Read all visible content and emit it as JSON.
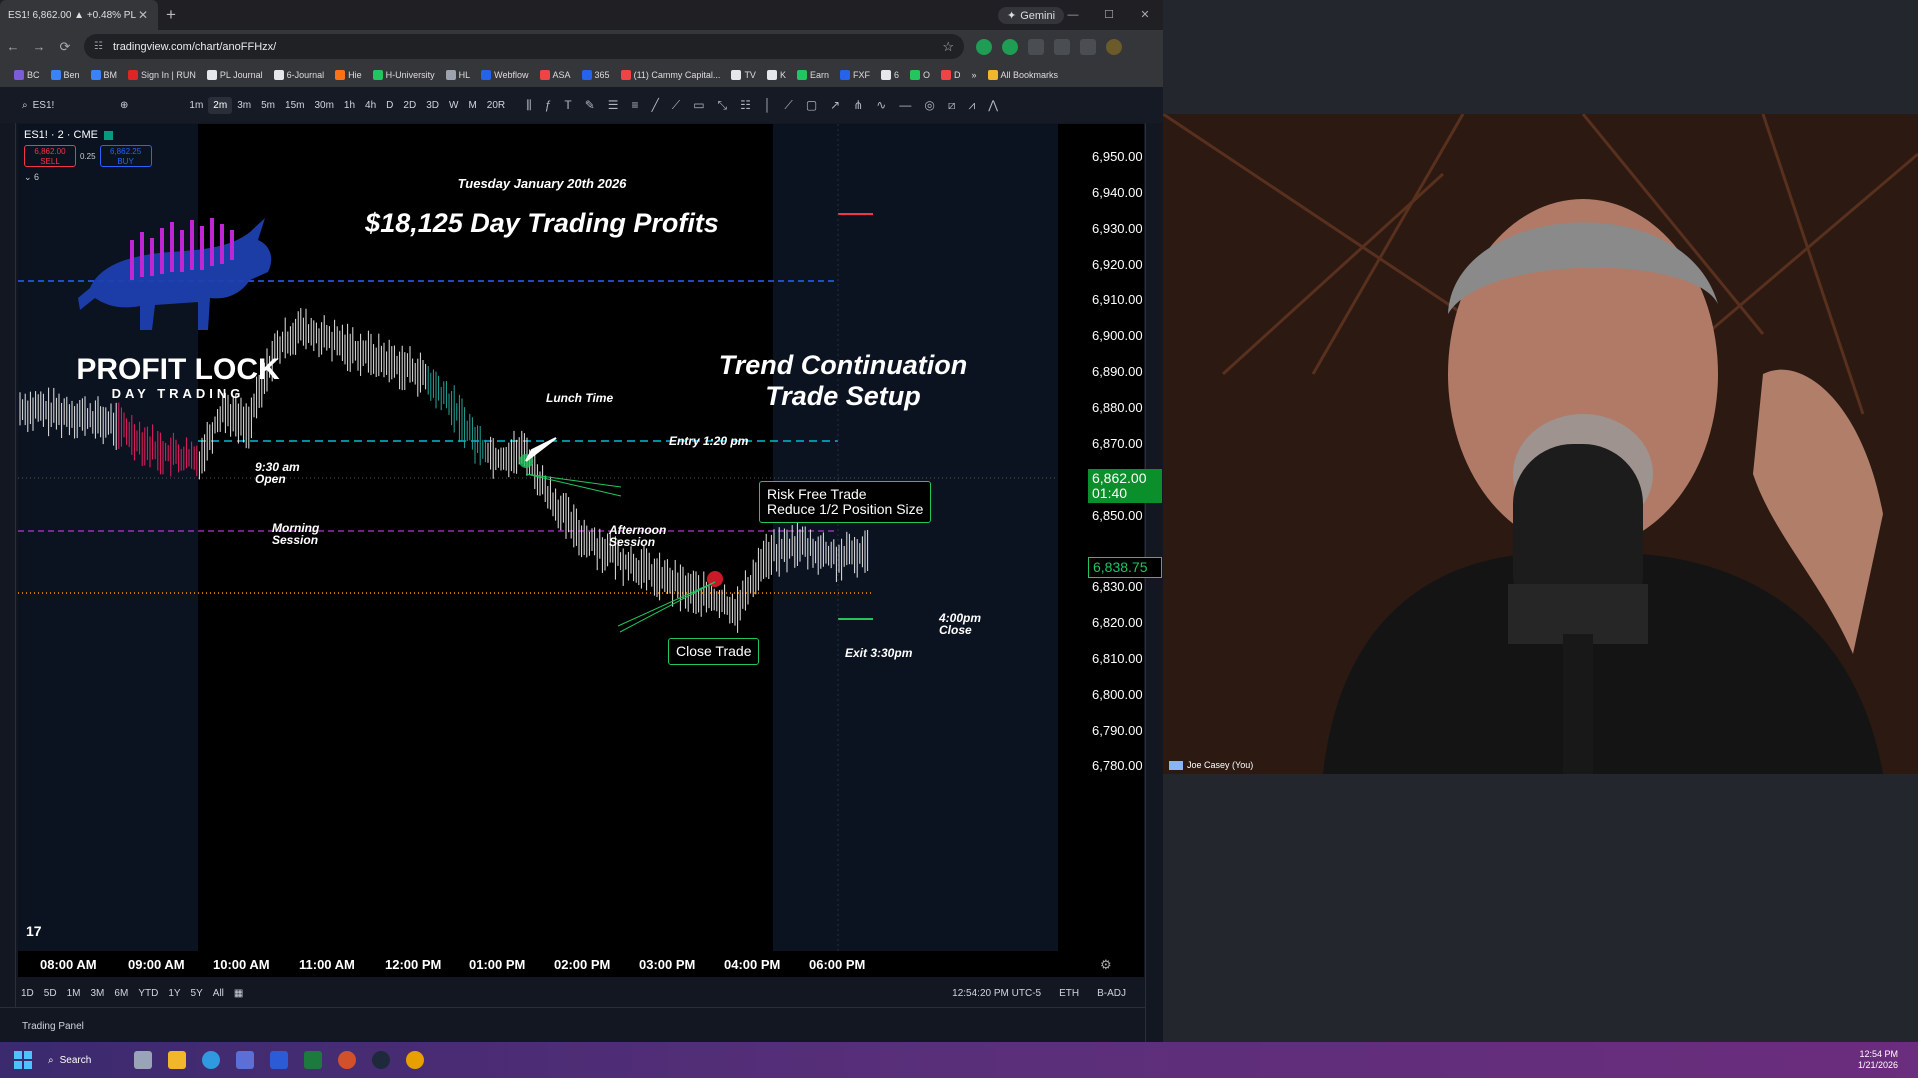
{
  "browser": {
    "tab_title": "ES1! 6,862.00 ▲ +0.48% PL – ...",
    "tab_close": "✕",
    "new_tab": "+",
    "gemini": "Gemini",
    "url": "tradingview.com/chart/anoFFHzx/",
    "bookmarks": [
      "BC",
      "Ben",
      "BM",
      "Sign In | RUN",
      "PL Journal",
      "6-Journal",
      "Hie",
      "H-University",
      "HL",
      "Webflow",
      "ASA",
      "365",
      "(11) Cammy Capital...",
      "TV",
      "K",
      "Earn",
      "FXF",
      "6",
      "O",
      "D",
      "»",
      "All Bookmarks"
    ]
  },
  "toolbar": {
    "symbol": "ES1!",
    "timeframes": [
      "1m",
      "2m",
      "3m",
      "5m",
      "15m",
      "30m",
      "1h",
      "4h",
      "D",
      "2D",
      "3D",
      "W",
      "M",
      "20R"
    ],
    "active_timeframe": "2m"
  },
  "chart": {
    "legend_title": "ES1! · 2 · CME",
    "sell_price": "6,862.00",
    "sell_label": "SELL",
    "spread": "0.25",
    "buy_price": "6,862.25",
    "buy_label": "BUY",
    "indicator_count": "6",
    "date_title": "Tuesday January 20th 2026",
    "profit_title": "$18,125 Day Trading Profits",
    "logo_text": "PROFIT LOCK",
    "logo_sub": "DAY TRADING",
    "setup_title_1": "Trend Continuation",
    "setup_title_2": "Trade Setup",
    "lunch_label": "Lunch Time",
    "entry_label": "Entry 1:20 pm",
    "open_label_1": "9:30 am",
    "open_label_2": "Open",
    "morning_label_1": "Morning",
    "morning_label_2": "Session",
    "afternoon_label_1": "Afternoon",
    "afternoon_label_2": "Session",
    "close_label_1": "4:00pm",
    "close_label_2": "Close",
    "exit_label": "Exit 3:30pm",
    "risk_box_1": "Risk Free Trade",
    "risk_box_2": "Reduce 1/2 Position Size",
    "close_box": "Close Trade",
    "price_labels": [
      "6,950.00",
      "6,940.00",
      "6,930.00",
      "6,920.00",
      "6,910.00",
      "6,900.00",
      "6,890.00",
      "6,880.00",
      "6,870.00",
      "6,850.00",
      "6,830.00",
      "6,820.00",
      "6,810.00",
      "6,800.00",
      "6,790.00",
      "6,780.00"
    ],
    "current_price": "6,862.00",
    "countdown": "01:40",
    "last_price_tag": "6,838.75",
    "time_labels": [
      "08:00 AM",
      "09:00 AM",
      "10:00 AM",
      "11:00 AM",
      "12:00 PM",
      "01:00 PM",
      "02:00 PM",
      "03:00 PM",
      "04:00 PM",
      "06:00 PM"
    ],
    "colors": {
      "up": "#ffffff",
      "down": "#e91e63",
      "entry_line": "#00bcd4",
      "session_line": "#2962ff",
      "stop_line": "#e040fb",
      "exit_line": "#ff9800"
    }
  },
  "bottom": {
    "ranges": [
      "1D",
      "5D",
      "1M",
      "3M",
      "6M",
      "YTD",
      "1Y",
      "5Y",
      "All"
    ],
    "clock": "12:54:20 PM UTC-5",
    "session": "ETH",
    "adj": "B-ADJ",
    "trading_panel": "Trading Panel"
  },
  "video": {
    "participant": "Joe Casey (You)"
  },
  "taskbar": {
    "search": "Search",
    "time": "12:54 PM",
    "date": "1/21/2026"
  }
}
